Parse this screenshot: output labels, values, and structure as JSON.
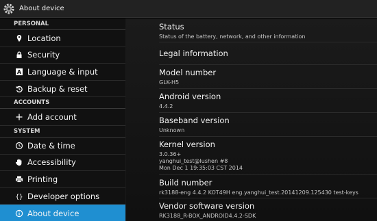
{
  "actionbar": {
    "title": "About device"
  },
  "sidebar": {
    "sections": [
      {
        "header": "PERSONAL",
        "items": [
          {
            "label": "Location",
            "icon": "location-pin-icon"
          },
          {
            "label": "Security",
            "icon": "lock-icon"
          },
          {
            "label": "Language & input",
            "icon": "keyboard-icon"
          },
          {
            "label": "Backup & reset",
            "icon": "backup-icon"
          }
        ]
      },
      {
        "header": "ACCOUNTS",
        "items": [
          {
            "label": "Add account",
            "icon": "plus-icon"
          }
        ]
      },
      {
        "header": "SYSTEM",
        "items": [
          {
            "label": "Date & time",
            "icon": "clock-icon"
          },
          {
            "label": "Accessibility",
            "icon": "hand-icon"
          },
          {
            "label": "Printing",
            "icon": "printer-icon"
          },
          {
            "label": "Developer options",
            "icon": "braces-icon"
          },
          {
            "label": "About device",
            "icon": "info-icon",
            "selected": true
          }
        ]
      }
    ]
  },
  "detail": {
    "rows": [
      {
        "title": "Status",
        "summary": [
          "Status of the battery, network, and other information"
        ]
      },
      {
        "title": "Legal information",
        "summary": []
      },
      {
        "title": "Model number",
        "summary": [
          "GLK-H5"
        ]
      },
      {
        "title": "Android version",
        "summary": [
          "4.4.2"
        ]
      },
      {
        "title": "Baseband version",
        "summary": [
          "Unknown"
        ]
      },
      {
        "title": "Kernel version",
        "summary": [
          "3.0.36+",
          "yanghui_test@lushen #8",
          "Mon Dec 1 19:35:03 CST 2014"
        ]
      },
      {
        "title": "Build number",
        "summary": [
          "rk3188-eng 4.4.2 KOT49H eng.yanghui_test.20141209.125430 test-keys"
        ]
      },
      {
        "title": "Vendor software version",
        "summary": [
          "RK3188_R-BOX_ANDROID4.4.2-SDK"
        ]
      }
    ]
  },
  "colors": {
    "accent": "#1f8fd1",
    "background": "#111111"
  }
}
